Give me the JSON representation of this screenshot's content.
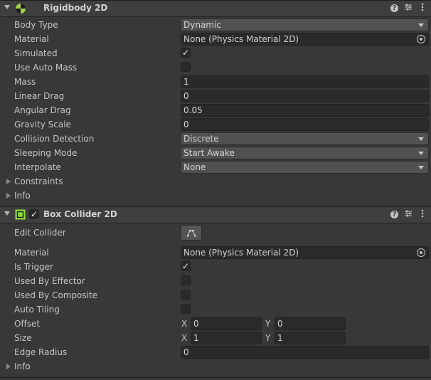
{
  "rigidbody": {
    "title": "Rigidbody 2D",
    "help_icon": "?",
    "fields": {
      "body_type": {
        "label": "Body Type",
        "value": "Dynamic"
      },
      "material": {
        "label": "Material",
        "value": "None (Physics Material 2D)"
      },
      "simulated": {
        "label": "Simulated",
        "checked": true,
        "mark": "✓"
      },
      "use_auto_mass": {
        "label": "Use Auto Mass",
        "checked": false
      },
      "mass": {
        "label": "Mass",
        "value": "1"
      },
      "linear_drag": {
        "label": "Linear Drag",
        "value": "0"
      },
      "angular_drag": {
        "label": "Angular Drag",
        "value": "0.05"
      },
      "gravity_scale": {
        "label": "Gravity Scale",
        "value": "0"
      },
      "collision_detection": {
        "label": "Collision Detection",
        "value": "Discrete"
      },
      "sleeping_mode": {
        "label": "Sleeping Mode",
        "value": "Start Awake"
      },
      "interpolate": {
        "label": "Interpolate",
        "value": "None"
      },
      "constraints": {
        "label": "Constraints"
      },
      "info": {
        "label": "Info"
      }
    }
  },
  "box_collider": {
    "title": "Box Collider 2D",
    "enabled_mark": "✓",
    "help_icon": "?",
    "fields": {
      "edit_collider": {
        "label": "Edit Collider"
      },
      "material": {
        "label": "Material",
        "value": "None (Physics Material 2D)"
      },
      "is_trigger": {
        "label": "Is Trigger",
        "checked": true,
        "mark": "✓"
      },
      "used_by_effector": {
        "label": "Used By Effector",
        "checked": false
      },
      "used_by_composite": {
        "label": "Used By Composite",
        "checked": false
      },
      "auto_tiling": {
        "label": "Auto Tiling",
        "checked": false
      },
      "offset": {
        "label": "Offset",
        "x_label": "X",
        "x": "0",
        "y_label": "Y",
        "y": "0"
      },
      "size": {
        "label": "Size",
        "x_label": "X",
        "x": "1",
        "y_label": "Y",
        "y": "1"
      },
      "edge_radius": {
        "label": "Edge Radius",
        "value": "0"
      },
      "info": {
        "label": "Info"
      }
    }
  },
  "colors": {
    "background": "#383838",
    "header": "#3e3e3e",
    "field": "#2a2a2a",
    "dropdown": "#515151",
    "rigidbody_icon": "#a4d34a",
    "collider_icon": "#8ddc3c"
  },
  "icons": [
    "foldout-arrow-icon",
    "rigidbody-2d-icon",
    "box-collider-2d-icon",
    "help-icon",
    "presets-icon",
    "menu-kebab-icon",
    "object-picker-icon",
    "edit-collider-icon",
    "checkmark-icon"
  ]
}
